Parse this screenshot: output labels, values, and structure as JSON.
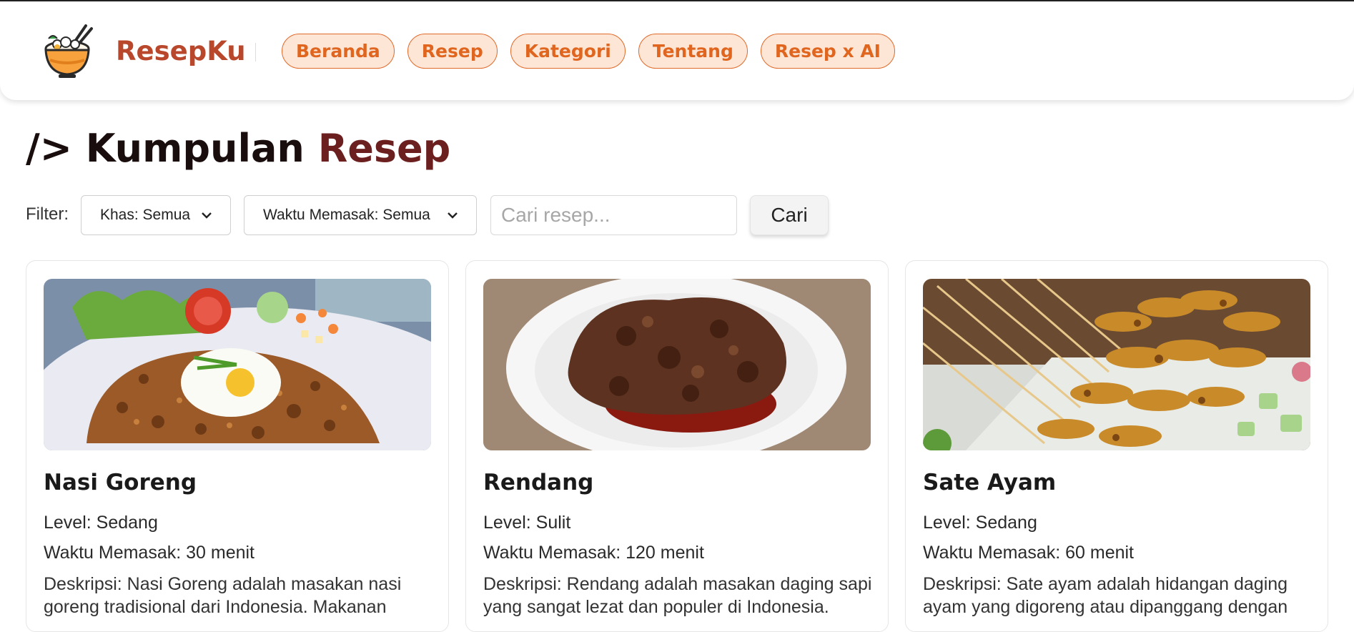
{
  "brand": {
    "name": "ResepKu",
    "logo_icon": "rice-bowl-icon"
  },
  "nav": {
    "items": [
      {
        "label": "Beranda"
      },
      {
        "label": "Resep"
      },
      {
        "label": "Kategori"
      },
      {
        "label": "Tentang"
      },
      {
        "label": "Resep x AI"
      }
    ]
  },
  "page": {
    "title_prefix": "/> Kumpulan",
    "title_accent": "Resep"
  },
  "filters": {
    "label": "Filter:",
    "khas": {
      "value": "Khas: Semua"
    },
    "waktu": {
      "value": "Waktu Memasak: Semua"
    },
    "search": {
      "placeholder": "Cari resep...",
      "value": ""
    },
    "search_button": "Cari"
  },
  "recipes": [
    {
      "title": "Nasi Goreng",
      "level": "Level: Sedang",
      "time": "Waktu Memasak: 30 menit",
      "description": "Deskripsi: Nasi Goreng adalah masakan nasi goreng tradisional dari Indonesia. Makanan",
      "image": "fried-rice-photo"
    },
    {
      "title": "Rendang",
      "level": "Level: Sulit",
      "time": "Waktu Memasak: 120 menit",
      "description": "Deskripsi: Rendang adalah masakan daging sapi yang sangat lezat dan populer di Indonesia.",
      "image": "rendang-photo"
    },
    {
      "title": "Sate Ayam",
      "level": "Level: Sedang",
      "time": "Waktu Memasak: 60 menit",
      "description": "Deskripsi: Sate ayam adalah hidangan daging ayam yang digoreng atau dipanggang dengan",
      "image": "chicken-satay-photo"
    }
  ],
  "colors": {
    "brand": "#b8472b",
    "nav_border": "#e06a2a",
    "nav_bg": "#fde6d6",
    "title_accent": "#6b1f1f"
  }
}
